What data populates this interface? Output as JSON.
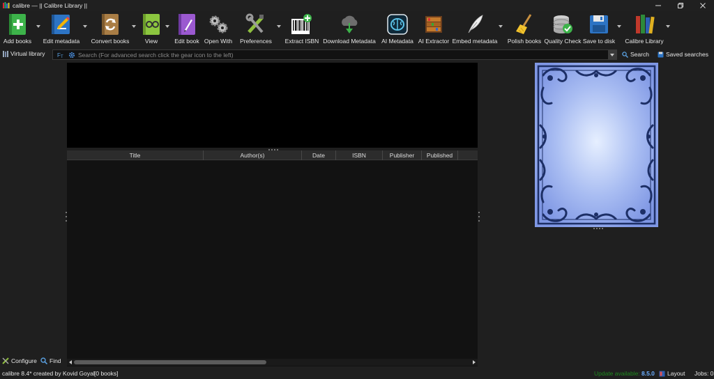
{
  "window": {
    "title": "calibre — || Calibre Library ||"
  },
  "toolbar": {
    "items": [
      {
        "label": "Add books",
        "icon": "add-book-icon"
      },
      {
        "label": "Edit metadata",
        "icon": "edit-metadata-icon"
      },
      {
        "label": "Convert books",
        "icon": "convert-icon"
      },
      {
        "label": "View",
        "icon": "view-icon"
      },
      {
        "label": "Edit book",
        "icon": "edit-book-icon"
      },
      {
        "label": "Open With",
        "icon": "gears-icon"
      },
      {
        "label": "Preferences",
        "icon": "preferences-icon"
      },
      {
        "label": "Extract ISBN",
        "icon": "barcode-icon"
      },
      {
        "label": "Download Metadata",
        "icon": "cloud-download-icon"
      },
      {
        "label": "AI Metadata",
        "icon": "ai-brain-icon"
      },
      {
        "label": "AI Extractor",
        "icon": "ai-extractor-icon"
      },
      {
        "label": "Embed metadata",
        "icon": "quill-icon"
      },
      {
        "label": "Polish books",
        "icon": "broom-icon"
      },
      {
        "label": "Quality Check",
        "icon": "quality-check-icon"
      },
      {
        "label": "Save to disk",
        "icon": "save-icon"
      },
      {
        "label": "Calibre Library",
        "icon": "library-icon"
      }
    ]
  },
  "search": {
    "virtual_library_label": "Virtual library",
    "placeholder": "Search (For advanced search click the gear icon to the left)",
    "search_button": "Search",
    "saved_searches_button": "Saved searches"
  },
  "booklist": {
    "columns": [
      "Title",
      "Author(s)",
      "Date",
      "ISBN",
      "Publisher",
      "Published"
    ]
  },
  "left_panel": {
    "configure_label": "Configure",
    "find_label": "Find"
  },
  "status": {
    "created_by": "calibre 8.4* created by Kovid Goyal",
    "book_count": "[0 books]",
    "update_label": "Update available:",
    "update_version": "8.5.0",
    "layout_label": "Layout",
    "jobs_label": "Jobs: 0"
  },
  "colors": {
    "background": "#1f1f1f",
    "cover_blue": "#8fa8ee",
    "accent_green": "#1f8a1f",
    "version_blue": "#6aaeff"
  }
}
